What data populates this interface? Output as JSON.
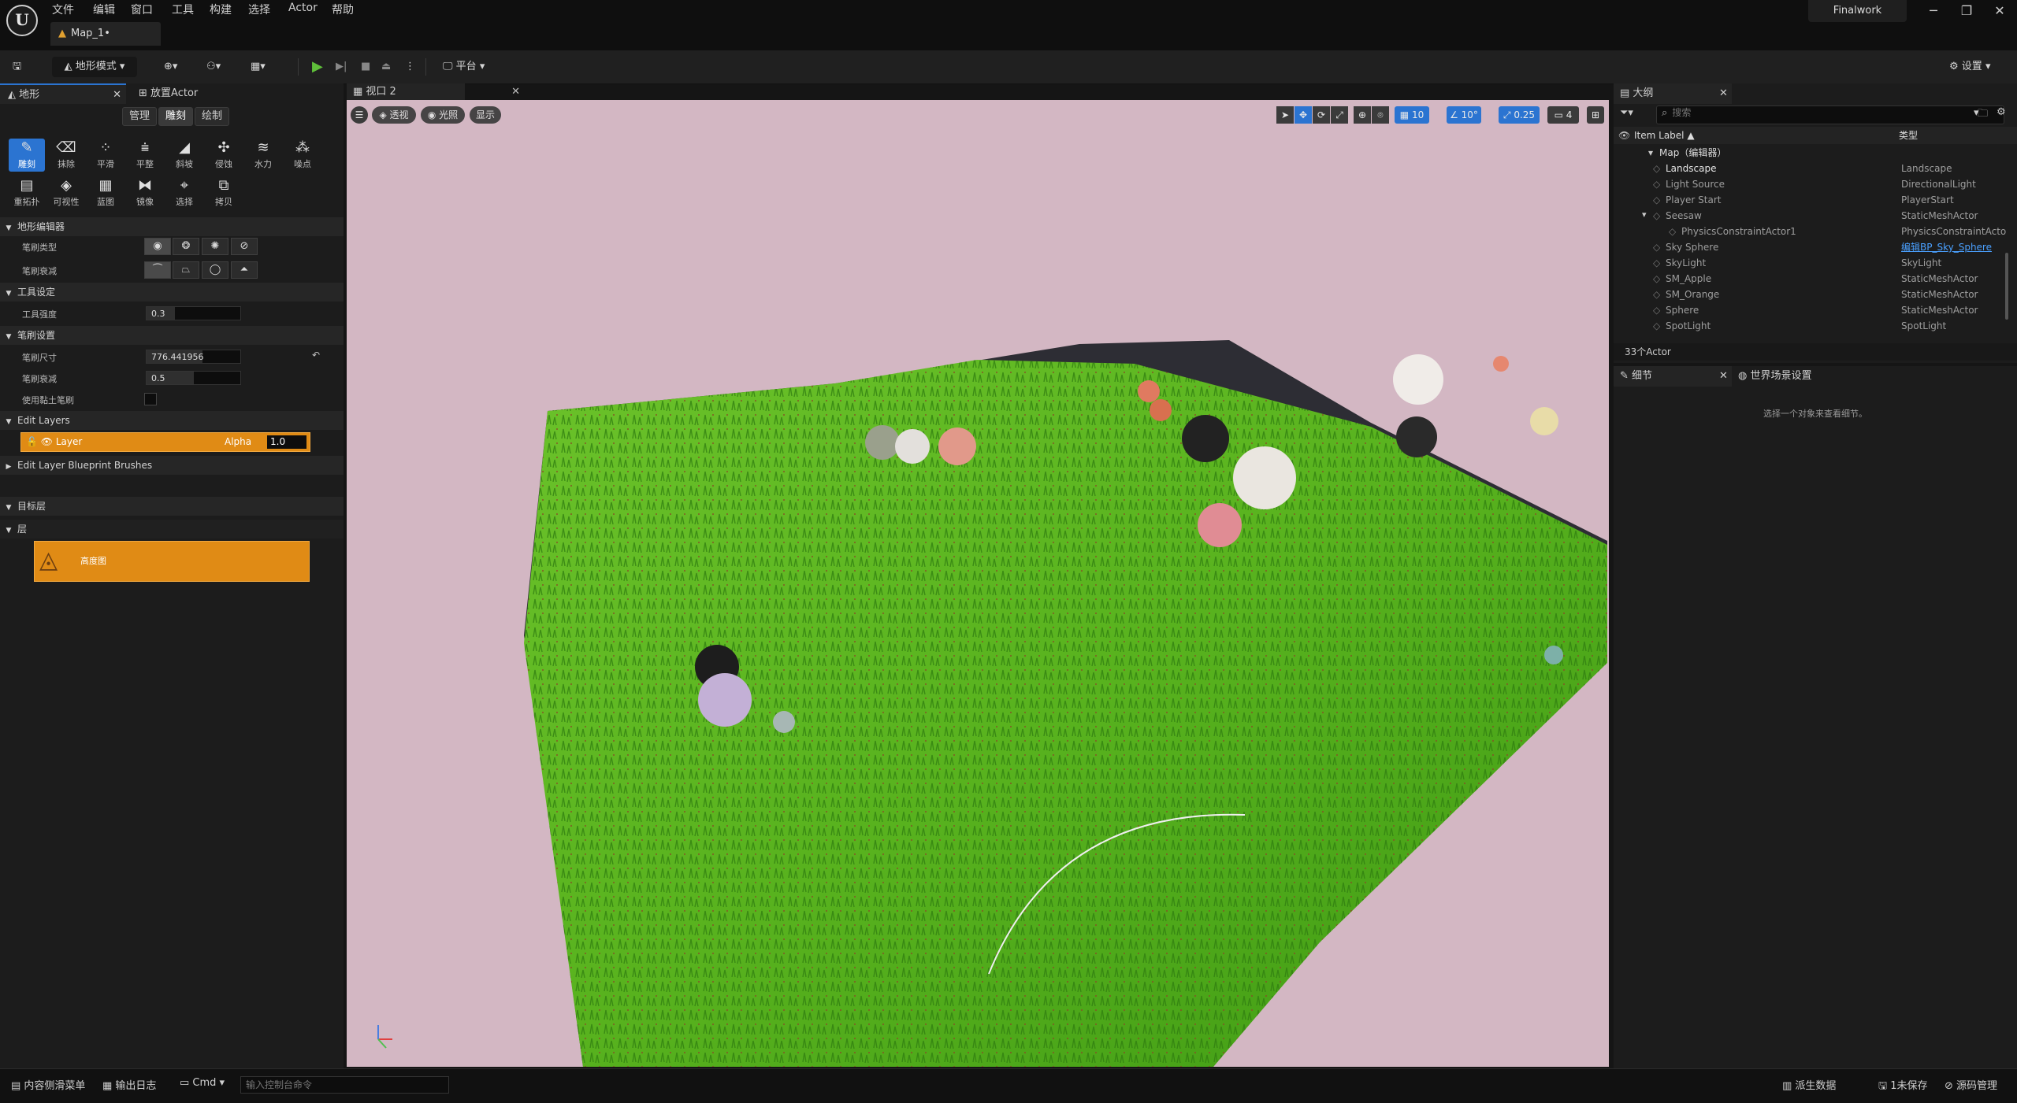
{
  "menu": [
    "文件",
    "编辑",
    "窗口",
    "工具",
    "构建",
    "选择",
    "Actor",
    "帮助"
  ],
  "map_tab": "Map_1•",
  "project_tab": "Finalwork",
  "window_controls": [
    "─",
    "❐",
    "✕"
  ],
  "toolbar": {
    "mode": "地形模式",
    "platform": "平台",
    "settings": "设置"
  },
  "left_panel": {
    "tabs": [
      "地形",
      "放置Actor"
    ],
    "subtabs": [
      "管理",
      "雕刻",
      "绘制"
    ],
    "tools_row1": [
      "雕刻",
      "抹除",
      "平滑",
      "平整",
      "斜坡",
      "侵蚀",
      "水力",
      "噪点"
    ],
    "tools_row2": [
      "重拓扑",
      "可视性",
      "蓝图",
      "镜像",
      "选择",
      "拷贝"
    ],
    "sections": {
      "editor": "地形编辑器",
      "tool_settings": "工具设定",
      "brush_settings": "笔刷设置",
      "edit_layers": "Edit Layers",
      "blueprint_brushes": "Edit Layer Blueprint Brushes",
      "target_layer": "目标层",
      "layer": "层"
    },
    "props": {
      "brush_type": "笔刷类型",
      "brush_falloff": "笔刷衰减",
      "tool_strength": "工具强度",
      "tool_strength_value": "0.3",
      "brush_size": "笔刷尺寸",
      "brush_size_value": "776.441956",
      "brush_falloff2": "笔刷衰减",
      "brush_falloff2_value": "0.5",
      "use_clay": "使用黏土笔刷"
    },
    "layer_row": {
      "name": "Layer",
      "alpha_label": "Alpha",
      "alpha_value": "1.0"
    },
    "heightmap_label": "高度图"
  },
  "viewport": {
    "tab": "视口 2",
    "left_buttons": [
      "透视",
      "光照",
      "显示"
    ],
    "grid": "10",
    "angle": "10°",
    "scale": "0.25",
    "camera": "4"
  },
  "outliner": {
    "tab": "大纲",
    "search_placeholder": "搜索",
    "col_label": "Item Label ▲",
    "col_type": "类型",
    "root": "Map（编辑器）",
    "rows": [
      {
        "name": "Landscape",
        "type": "Landscape"
      },
      {
        "name": "Light Source",
        "type": "DirectionalLight"
      },
      {
        "name": "Player Start",
        "type": "PlayerStart"
      },
      {
        "name": "Seesaw",
        "type": "StaticMeshActor"
      },
      {
        "name": "PhysicsConstraintActor1",
        "type": "PhysicsConstraintActo"
      },
      {
        "name": "Sky Sphere",
        "type": "编辑BP_Sky_Sphere"
      },
      {
        "name": "SkyLight",
        "type": "SkyLight"
      },
      {
        "name": "SM_Apple",
        "type": "StaticMeshActor"
      },
      {
        "name": "SM_Orange",
        "type": "StaticMeshActor"
      },
      {
        "name": "Sphere",
        "type": "StaticMeshActor"
      },
      {
        "name": "SpotLight",
        "type": "SpotLight"
      }
    ],
    "count": "33个Actor"
  },
  "details": {
    "tab": "细节",
    "world_tab": "世界场景设置",
    "hint": "选择一个对象来查看细节。"
  },
  "statusbar": {
    "content_drawer": "内容侧滑菜单",
    "output_log": "输出日志",
    "cmd": "Cmd",
    "cmd_placeholder": "输入控制台命令",
    "source_data": "派生数据",
    "unsaved": "1未保存",
    "source_control": "源码管理"
  }
}
